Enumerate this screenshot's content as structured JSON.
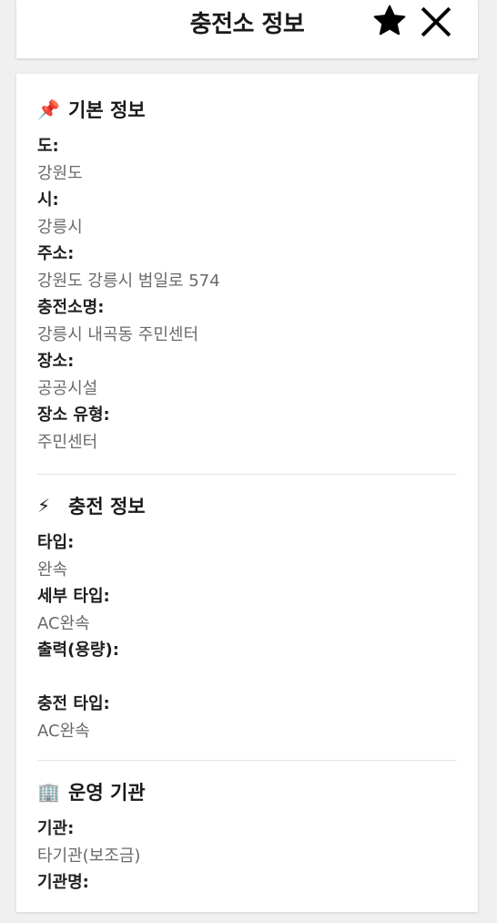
{
  "header": {
    "title": "충전소 정보"
  },
  "sections": {
    "basic": {
      "icon": "📌",
      "title": "기본 정보",
      "fields": [
        {
          "label": "도:",
          "value": "강원도"
        },
        {
          "label": "시:",
          "value": "강릉시"
        },
        {
          "label": "주소:",
          "value": "강원도 강릉시 범일로 574"
        },
        {
          "label": "충전소명:",
          "value": "강릉시 내곡동 주민센터"
        },
        {
          "label": "장소:",
          "value": "공공시설"
        },
        {
          "label": "장소 유형:",
          "value": "주민센터"
        }
      ]
    },
    "charging": {
      "icon": "⚡",
      "title": "충전 정보",
      "fields": [
        {
          "label": "타입:",
          "value": "완속"
        },
        {
          "label": "세부 타입:",
          "value": "AC완속"
        },
        {
          "label": "출력(용량):",
          "value": ""
        },
        {
          "label": "충전 타입:",
          "value": "AC완속"
        }
      ]
    },
    "operator": {
      "icon": "🏢",
      "title": "운영 기관",
      "fields": [
        {
          "label": "기관:",
          "value": "타기관(보조금)"
        },
        {
          "label": "기관명:",
          "value": ""
        }
      ]
    }
  }
}
